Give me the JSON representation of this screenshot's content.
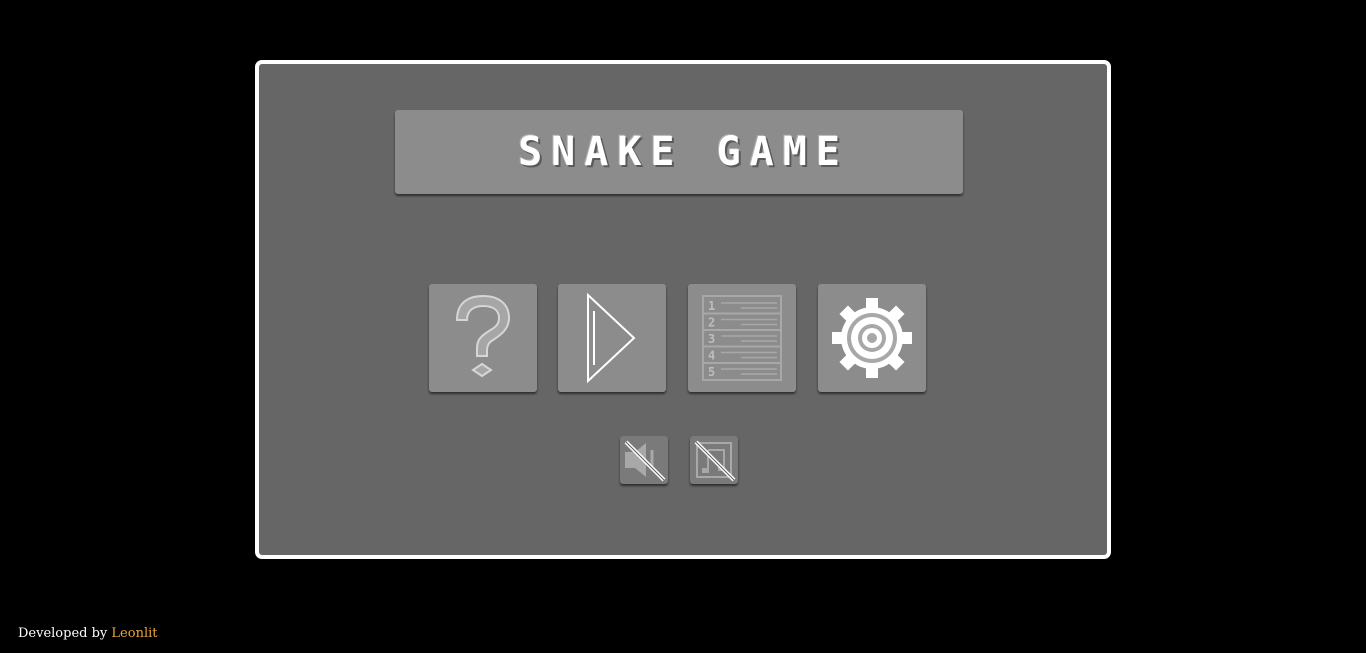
{
  "title": "SNAKE GAME",
  "menu": [
    {
      "id": "help",
      "icon": "question-mark-icon"
    },
    {
      "id": "play",
      "icon": "play-triangle-icon"
    },
    {
      "id": "leaderboard",
      "icon": "numbered-list-icon"
    },
    {
      "id": "settings",
      "icon": "gear-icon"
    }
  ],
  "toggles": [
    {
      "id": "sound",
      "icon": "speaker-muted-icon",
      "state": "off"
    },
    {
      "id": "music",
      "icon": "music-note-muted-icon",
      "state": "off"
    }
  ],
  "leaderboard_ranks": [
    "1",
    "2",
    "3",
    "4",
    "5"
  ],
  "footer": {
    "prefix": "Developed by",
    "author": "Leonlit"
  },
  "colors": {
    "background": "#000000",
    "panel": "#666666",
    "panel_border": "#ffffff",
    "button": "#8c8c8c",
    "author_link": "#e8a63a"
  }
}
